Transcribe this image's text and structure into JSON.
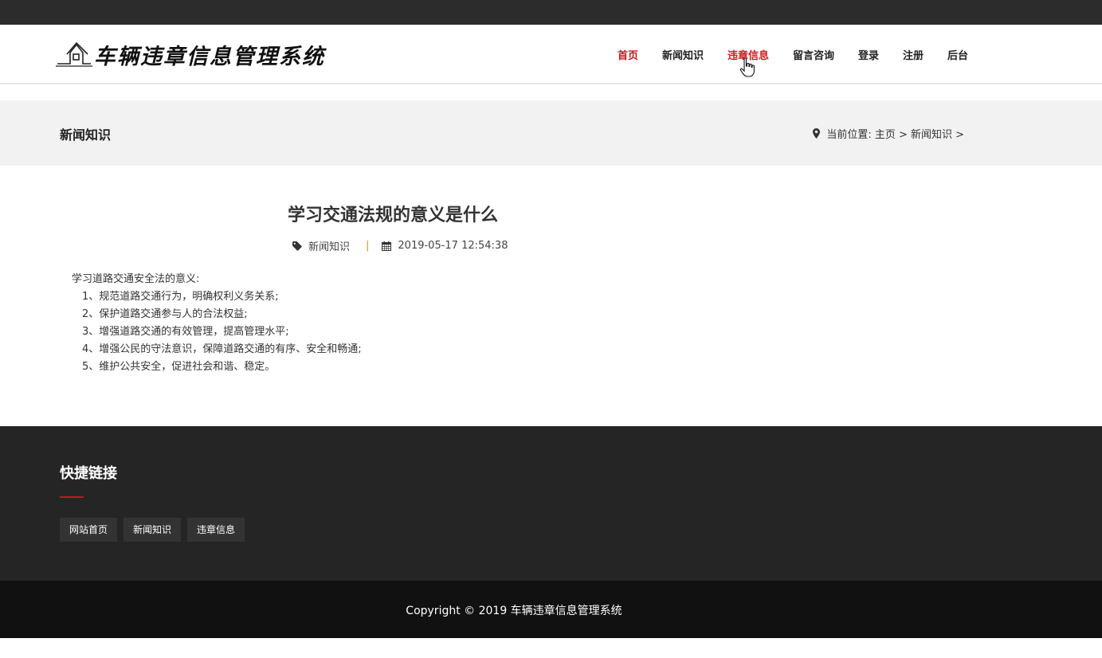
{
  "header": {
    "logo_text": "车辆违章信息管理系统",
    "nav": [
      {
        "label": "首页",
        "state": "active"
      },
      {
        "label": "新闻知识",
        "state": "normal"
      },
      {
        "label": "违章信息",
        "state": "hover"
      },
      {
        "label": "留言咨询",
        "state": "normal"
      },
      {
        "label": "登录",
        "state": "normal"
      },
      {
        "label": "注册",
        "state": "normal"
      },
      {
        "label": "后台",
        "state": "normal"
      }
    ]
  },
  "title_band": {
    "title": "新闻知识",
    "breadcrumb_prefix": "当前位置:",
    "breadcrumb_path": "主页 > 新闻知识 >"
  },
  "article": {
    "title": "学习交通法规的意义是什么",
    "category": "新闻知识",
    "separator": "|",
    "datetime": "2019-05-17 12:54:38",
    "intro": "学习道路交通安全法的意义:",
    "items": [
      "1、规范道路交通行为，明确权利义务关系;",
      "2、保护道路交通参与人的合法权益;",
      "3、增强道路交通的有效管理，提高管理水平;",
      "4、增强公民的守法意识，保障道路交通的有序、安全和畅通;",
      "5、维护公共安全，促进社会和谐、稳定。"
    ]
  },
  "footer": {
    "title": "快捷链接",
    "links": [
      "网站首页",
      "新闻知识",
      "违章信息"
    ],
    "copyright": "Copyright © 2019 车辆违章信息管理系统"
  },
  "colors": {
    "accent": "#c7161d",
    "footer_bg": "#252525",
    "copyright_bg": "#111111",
    "band_bg": "#f2f2f2"
  },
  "icons": [
    "house-logo-icon",
    "map-pin-icon",
    "tag-icon",
    "calendar-icon",
    "hand-cursor-icon"
  ]
}
